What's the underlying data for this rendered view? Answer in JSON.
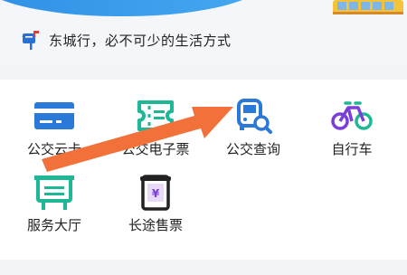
{
  "banner": {
    "slogan": "东城行，必不可少的生活方式"
  },
  "grid": [
    {
      "label": "公交云卡"
    },
    {
      "label": "公交电子票"
    },
    {
      "label": "公交查询"
    },
    {
      "label": "自行车"
    },
    {
      "label": "服务大厅"
    },
    {
      "label": "长途售票"
    }
  ],
  "colors": {
    "blue": "#2a78d8",
    "teal": "#1fb896",
    "purple": "#7a3fd8",
    "arrow": "#f2713a"
  }
}
